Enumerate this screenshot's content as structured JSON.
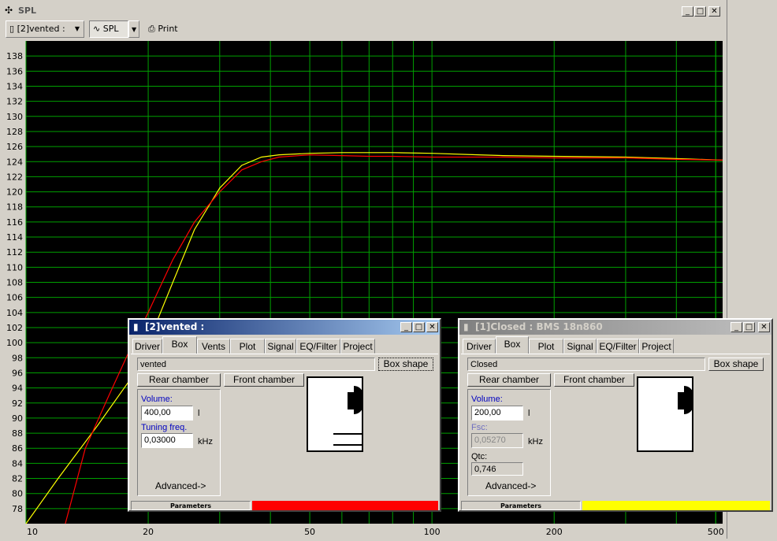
{
  "main_window": {
    "title": "SPL",
    "toolbar": {
      "project_selector": "[2]vented :",
      "view_button": "SPL",
      "print_button": "Print"
    }
  },
  "chart_data": {
    "type": "line",
    "xscale": "log",
    "xlim": [
      10,
      520
    ],
    "ylim": [
      76,
      140
    ],
    "x_ticks": [
      10,
      20,
      50,
      100,
      200,
      500
    ],
    "y_ticks": [
      78,
      80,
      82,
      84,
      86,
      88,
      90,
      92,
      94,
      96,
      98,
      100,
      102,
      104,
      106,
      108,
      110,
      112,
      114,
      116,
      118,
      120,
      122,
      124,
      126,
      128,
      130,
      132,
      134,
      136,
      138
    ],
    "grid": true,
    "background": "#000000",
    "grid_color": "#00a000",
    "series": [
      {
        "color": "#ffff00",
        "x": [
          10,
          12,
          15,
          18,
          20,
          23,
          26,
          30,
          34,
          38,
          42,
          50,
          60,
          70,
          80,
          100,
          130,
          150,
          200,
          300,
          400,
          520
        ],
        "y": [
          76,
          82,
          89,
          95,
          100,
          108,
          115,
          120.5,
          123.5,
          124.6,
          124.9,
          125.1,
          125.2,
          125.2,
          125.2,
          125.1,
          124.9,
          124.8,
          124.7,
          124.6,
          124.4,
          124.2
        ]
      },
      {
        "color": "#ff0000",
        "x": [
          12.5,
          14,
          16,
          18,
          20,
          23,
          26,
          30,
          34,
          38,
          42,
          50,
          60,
          70,
          80,
          100,
          130,
          150,
          200,
          300,
          400,
          520
        ],
        "y": [
          76,
          86,
          93,
          99,
          104,
          111,
          116,
          120,
          122.9,
          124,
          124.6,
          124.9,
          124.8,
          124.7,
          124.7,
          124.6,
          124.6,
          124.6,
          124.5,
          124.5,
          124.3,
          124.2
        ]
      }
    ]
  },
  "vented_window": {
    "title": "[2]vented :",
    "tabs": [
      "Driver",
      "Box",
      "Vents",
      "Plot",
      "Signal",
      "EQ/Filter",
      "Project"
    ],
    "active_tab": "Box",
    "name_field": "vented",
    "box_shape_button": "Box shape",
    "rear_chamber_button": "Rear chamber",
    "front_chamber_button": "Front chamber",
    "volume_label": "Volume:",
    "volume_value": "400,00",
    "volume_unit": "l",
    "tuning_label": "Tuning freq.",
    "tuning_value": "0,03000",
    "tuning_unit": "kHz",
    "advanced_button": "Advanced->",
    "status_label": "Parameters",
    "status_color": "#ff0000"
  },
  "closed_window": {
    "title": "[1]Closed : BMS 18n860",
    "tabs": [
      "Driver",
      "Box",
      "Plot",
      "Signal",
      "EQ/Filter",
      "Project"
    ],
    "active_tab": "Box",
    "name_field": "Closed",
    "box_shape_button": "Box shape",
    "rear_chamber_button": "Rear chamber",
    "front_chamber_button": "Front chamber",
    "volume_label": "Volume:",
    "volume_value": "200,00",
    "volume_unit": "l",
    "fsc_label": "Fsc:",
    "fsc_value": "0,05270",
    "fsc_unit": "kHz",
    "qtc_label": "Qtc:",
    "qtc_value": "0,746",
    "advanced_button": "Advanced->",
    "status_label": "Parameters",
    "status_color": "#ffff00"
  },
  "icons": [
    "app-icon",
    "doc-icon",
    "sine-wave-icon",
    "printer-icon",
    "minimize-icon",
    "maximize-icon",
    "close-icon",
    "dropdown-arrow-icon",
    "speaker-driver-icon"
  ]
}
